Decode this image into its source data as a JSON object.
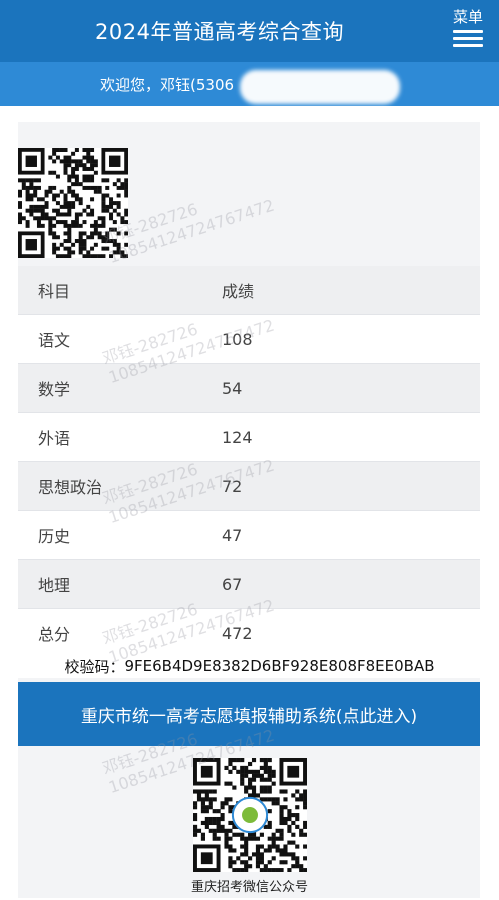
{
  "header": {
    "title": "2024年普通高考综合查询",
    "menu_label": "菜单"
  },
  "welcome": {
    "text": "欢迎您，邓钰(5306"
  },
  "scores": {
    "headers": [
      "科目",
      "成绩"
    ],
    "rows": [
      {
        "subject": "语文",
        "score": "108"
      },
      {
        "subject": "数学",
        "score": "54"
      },
      {
        "subject": "外语",
        "score": "124"
      },
      {
        "subject": "思想政治",
        "score": "72"
      },
      {
        "subject": "历史",
        "score": "47"
      },
      {
        "subject": "地理",
        "score": "67"
      },
      {
        "subject": "总分",
        "score": "472"
      }
    ]
  },
  "checksum": {
    "label": "校验码：",
    "value": "9FE6B4D9E8382D6BF928E808F8EE0BAB"
  },
  "banner": {
    "text": "重庆市统一高考志愿填报辅助系统(点此进入)"
  },
  "qr_caption": "重庆招考微信公众号",
  "watermark": {
    "line1": "邓钰-282726",
    "line2": "10854124724767472"
  },
  "colors": {
    "header_bg": "#1b74bd",
    "welcome_bg": "#2e8ad6"
  }
}
